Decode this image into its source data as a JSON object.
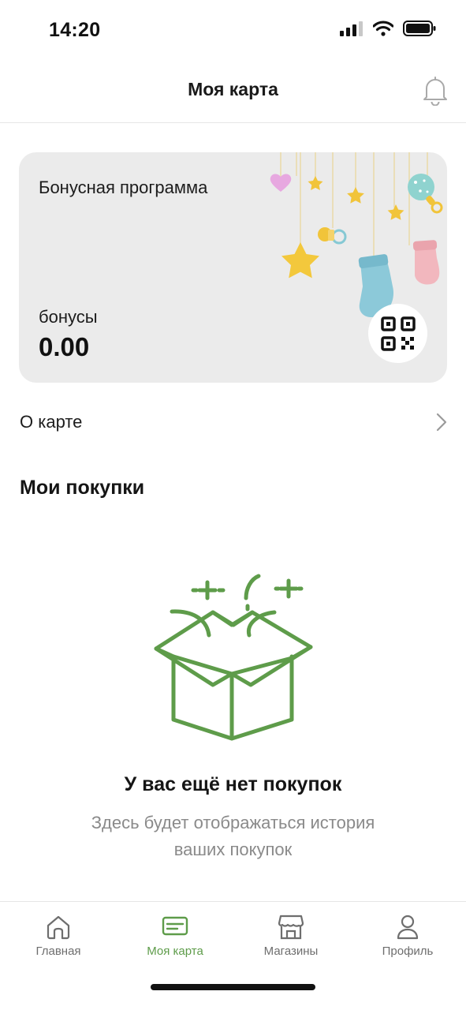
{
  "status_bar": {
    "time": "14:20"
  },
  "header": {
    "title": "Моя карта",
    "bell_icon": "bell-icon"
  },
  "card": {
    "title": "Бонусная программа",
    "bonus_label": "бонусы",
    "bonus_value": "0.00",
    "qr_icon": "qr-code-icon",
    "background": "#ebebeb"
  },
  "about": {
    "label": "О карте",
    "chevron_icon": "chevron-right-icon"
  },
  "purchases": {
    "title": "Мои покупки",
    "empty_title": "У вас ещё нет покупок",
    "empty_subtitle": "Здесь будет отображаться история ваших покупок",
    "illustration_icon": "open-box-icon"
  },
  "tabbar": {
    "accent": "#5e9c4a",
    "items": [
      {
        "label": "Главная",
        "icon": "home-icon",
        "active": false
      },
      {
        "label": "Моя карта",
        "icon": "card-icon",
        "active": true
      },
      {
        "label": "Магазины",
        "icon": "store-icon",
        "active": false
      },
      {
        "label": "Профиль",
        "icon": "profile-icon",
        "active": false
      }
    ]
  }
}
